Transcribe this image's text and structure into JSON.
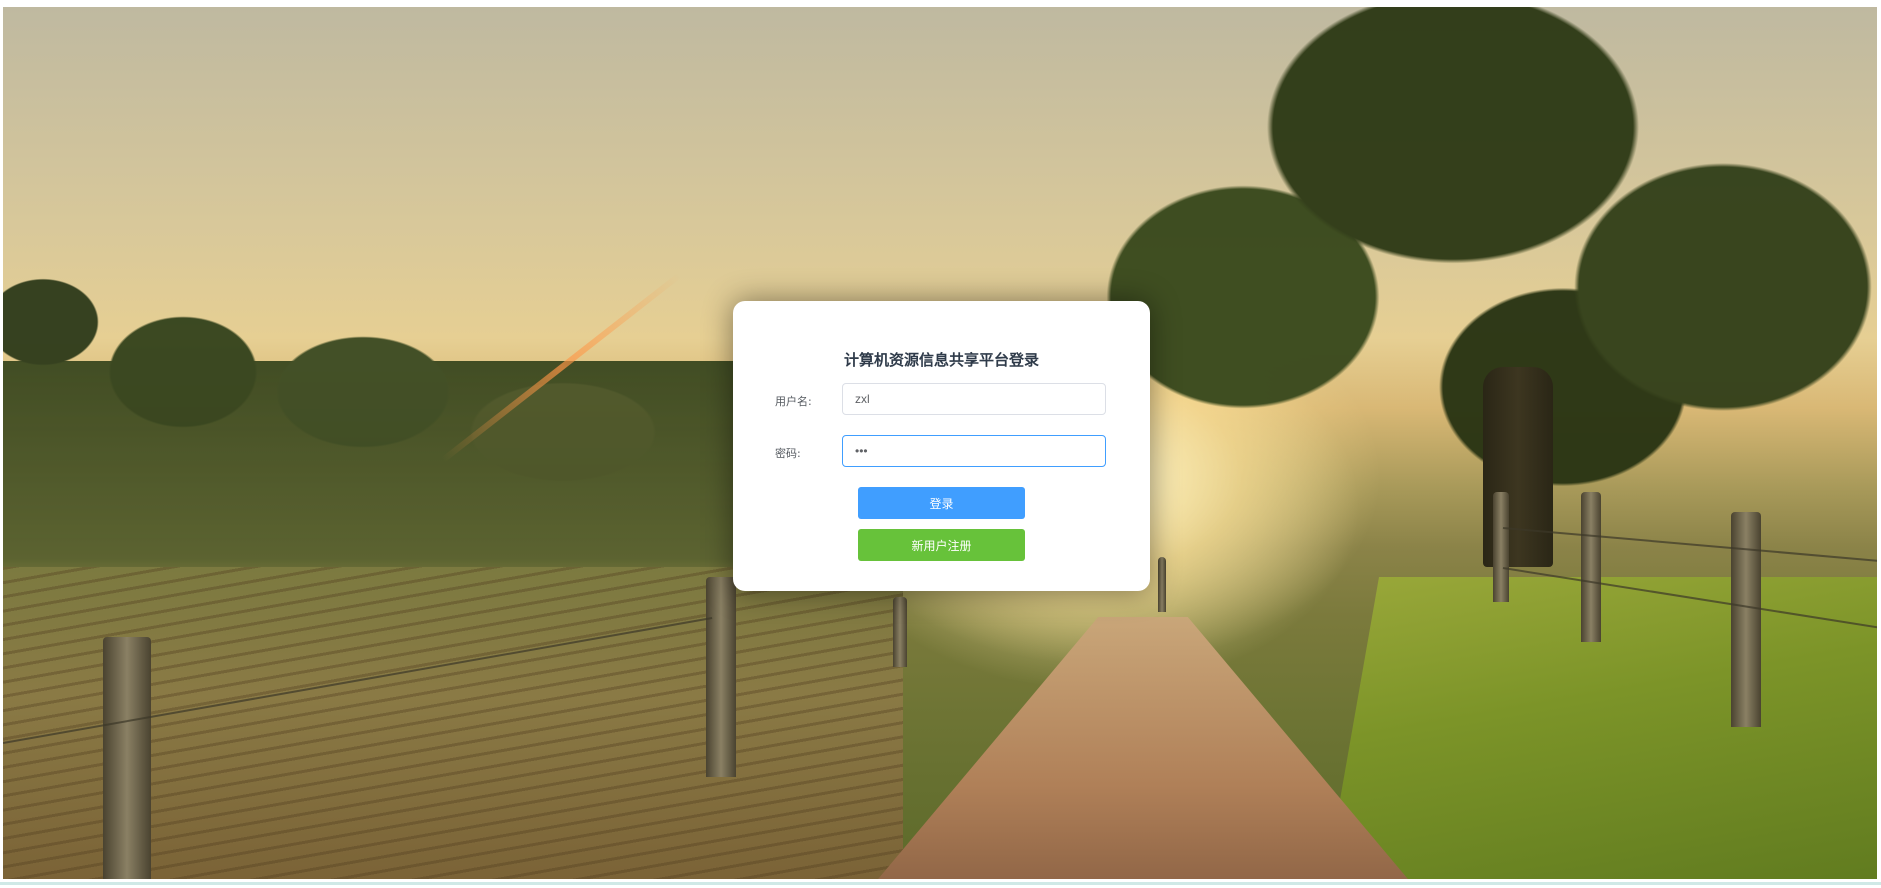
{
  "background": {
    "description_icon": "landscape-photo-background"
  },
  "login": {
    "title": "计算机资源信息共享平台登录",
    "username_label": "用户名:",
    "username_value": "zxl",
    "password_label": "密码:",
    "password_value": "•••",
    "login_button": "登录",
    "register_button": "新用户注册"
  },
  "colors": {
    "primary": "#409eff",
    "success": "#67c23a",
    "card_bg": "#ffffff"
  }
}
